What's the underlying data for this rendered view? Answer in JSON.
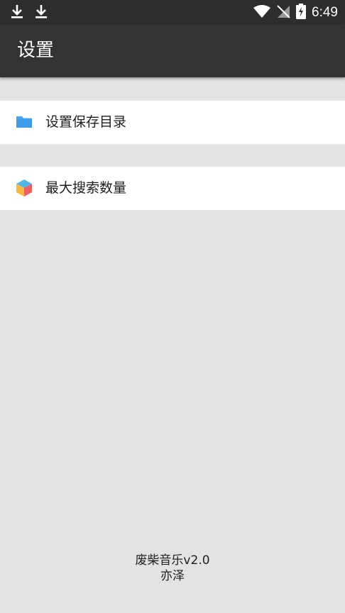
{
  "status_bar": {
    "time": "6:49",
    "icons": [
      "download-icon",
      "download-icon",
      "wifi-icon",
      "no-signal-icon",
      "battery-charging-icon"
    ]
  },
  "app_bar": {
    "title": "设置"
  },
  "settings": {
    "items": [
      {
        "label": "设置保存目录",
        "icon": "folder-icon",
        "icon_color": "#42a5f5"
      },
      {
        "label": "最大搜索数量",
        "icon": "cube-icon"
      }
    ]
  },
  "footer": {
    "app_version": "废柴音乐v2.0",
    "author": "亦泽"
  },
  "colors": {
    "status_bar": "#2d2d2d",
    "app_bar": "#333333",
    "background": "#e3e3e3",
    "item_background": "#ffffff"
  }
}
